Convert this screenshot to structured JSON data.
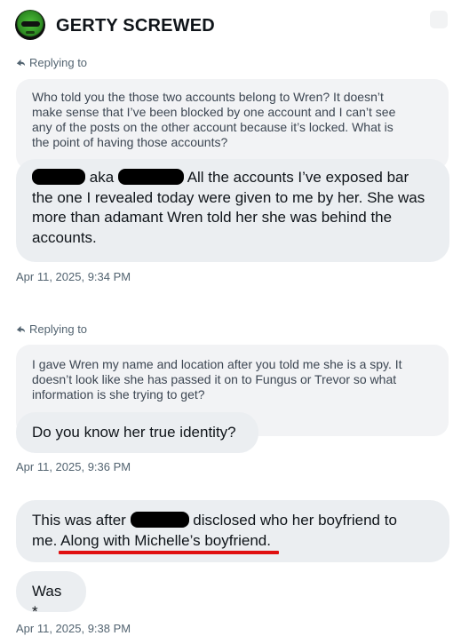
{
  "header": {
    "name": "GERTY SCREWED"
  },
  "threads": [
    {
      "replying_label": "Replying to",
      "quote_lines": [
        "Who told you the those two accounts belong to Wren? It doesn’t",
        "make sense that I’ve been blocked by one account and I can’t see",
        "any of the posts on the other account because it’s locked. What is",
        "the point of having those accounts?"
      ],
      "message": {
        "seg1": "aka",
        "seg2": "All the accounts I’ve exposed bar",
        "line2": "the one I revealed today were given to me by her. She was",
        "line3": "more than adamant Wren told her she was behind the",
        "line4": "accounts."
      },
      "timestamp": "Apr 11, 2025, 9:34 PM"
    },
    {
      "replying_label": "Replying to",
      "quote_lines": [
        "I gave Wren my name and location after you told me she is a spy. It",
        "doesn’t look like she has passed it on to Fungus or Trevor so what",
        "information is she trying to get?"
      ],
      "message": "Do you know her true identity?",
      "timestamp": "Apr 11, 2025, 9:36 PM"
    },
    {
      "message": {
        "seg1": "This was after",
        "seg2": "disclosed who her boyfriend to",
        "line2a": "me. ",
        "line2b": "Along with Michelle’s boyfriend",
        "line2c": "."
      },
      "followup": "Was *",
      "timestamp": "Apr 11, 2025, 9:38 PM"
    }
  ],
  "colors": {
    "underline": "#e01010",
    "bubble": "#ebeef1",
    "quote": "#f2f3f5",
    "muted": "#536471"
  }
}
